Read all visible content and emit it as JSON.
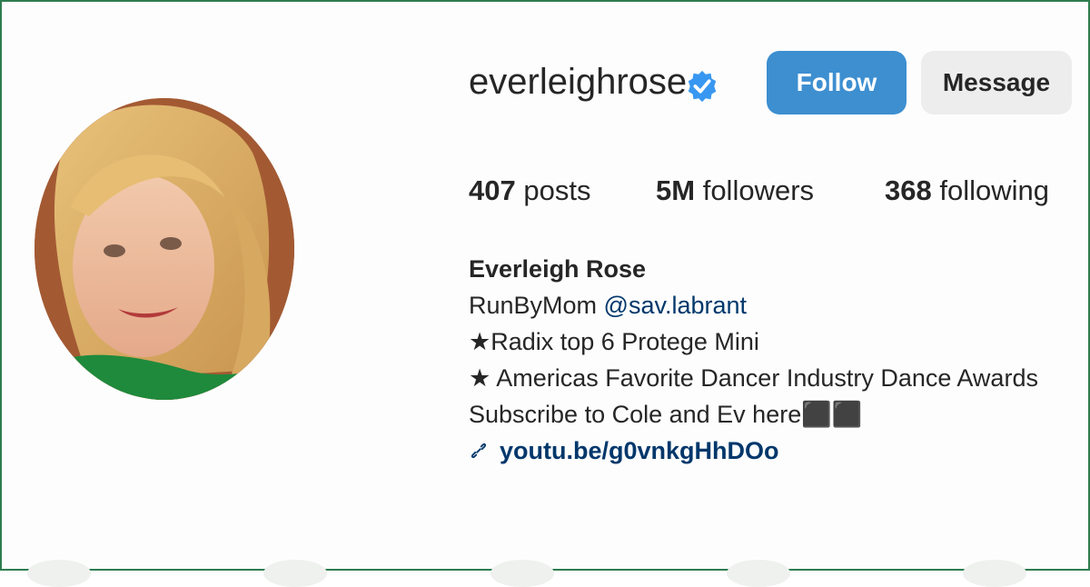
{
  "profile": {
    "username": "everleighrose",
    "verified_icon": "verified-badge-icon",
    "follow_label": "Follow",
    "message_label": "Message",
    "avatar_icon": "profile-photo"
  },
  "stats": {
    "posts_count": "407",
    "posts_label": "posts",
    "followers_count": "5M",
    "followers_label": "followers",
    "following_count": "368",
    "following_label": "following"
  },
  "bio": {
    "display_name": "Everleigh Rose",
    "line1_text": "RunByMom ",
    "line1_mention": "@sav.labrant",
    "line2": "★Radix top 6 Protege Mini",
    "line3": "★ Americas Favorite Dancer Industry Dance Awards",
    "line4": "Subscribe to Cole and Ev here⬛⬛",
    "link": "youtu.be/g0vnkgHhDOo"
  },
  "colors": {
    "accent": "#3d8fd0",
    "link": "#00376b",
    "border": "#2e7d4f"
  }
}
